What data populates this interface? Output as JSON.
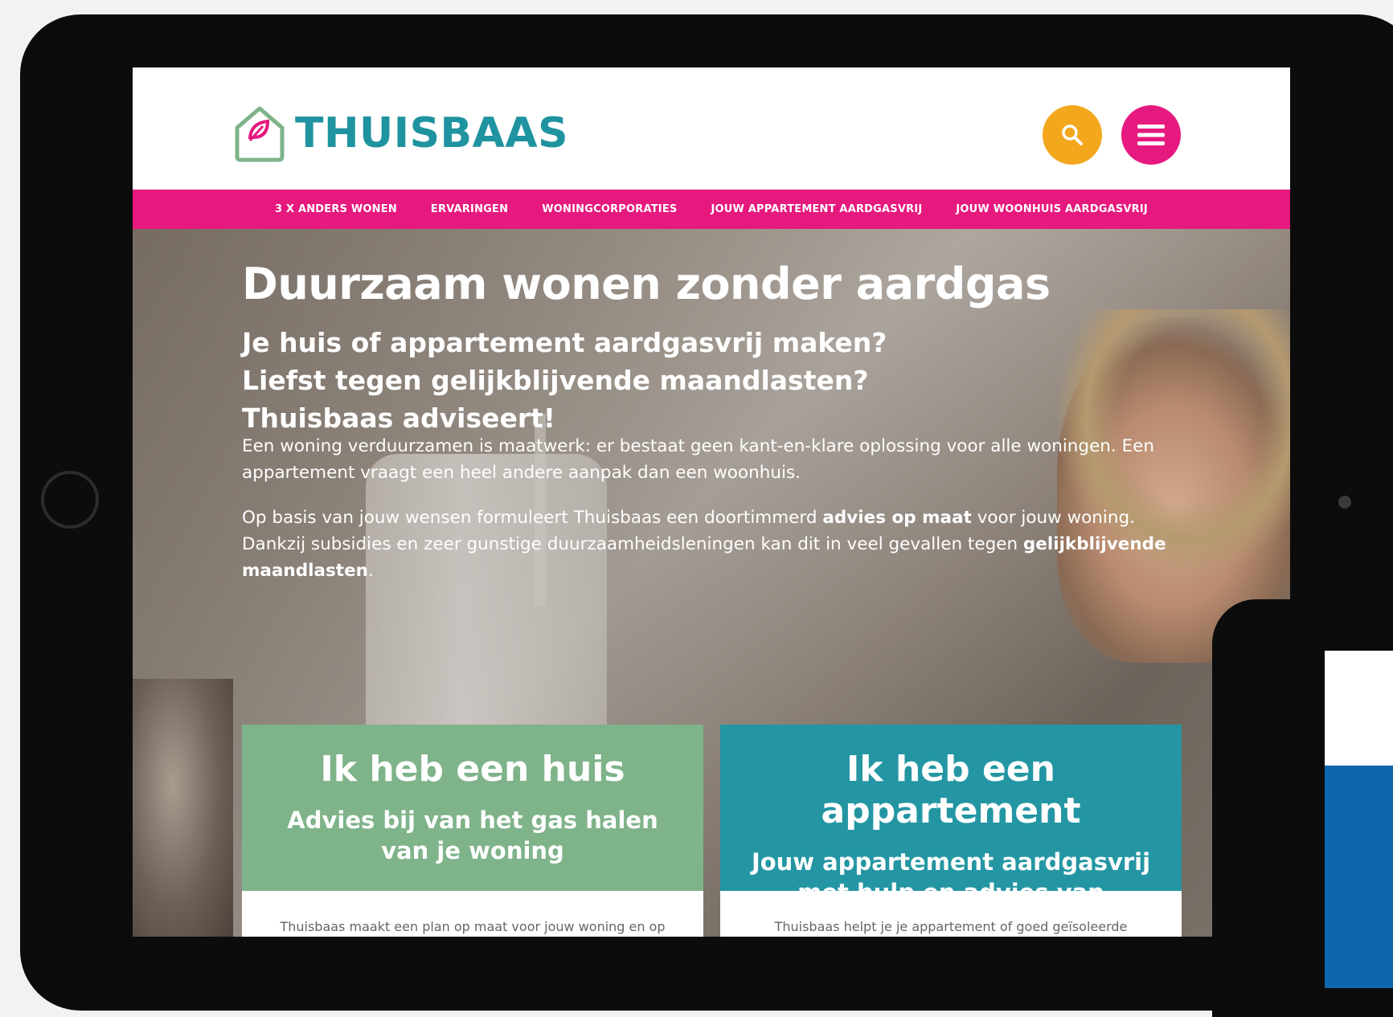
{
  "brand": {
    "name": "THUISBAAS",
    "colors": {
      "teal": "#1f93a0",
      "pink": "#e6197f",
      "yellow": "#f2a71c",
      "green": "#7fb38a"
    }
  },
  "header": {
    "search_icon": "search-icon",
    "menu_icon": "menu-icon"
  },
  "nav": {
    "items": [
      "3 X ANDERS WONEN",
      "ERVARINGEN",
      "WONINGCORPORATIES",
      "JOUW APPARTEMENT AARDGASVRIJ",
      "JOUW WOONHUIS AARDGASVRIJ"
    ]
  },
  "hero": {
    "title": "Duurzaam wonen zonder aardgas",
    "subtitle_lines": [
      "Je huis of appartement aardgasvrij maken?",
      "Liefst tegen gelijkblijvende maandlasten?",
      "Thuisbaas adviseert!"
    ],
    "paragraph1": "Een woning verduurzamen is maatwerk: er bestaat geen kant-en-klare oplossing voor alle woningen. Een appartement vraagt een heel andere aanpak dan een woonhuis.",
    "paragraph2": {
      "part1": "Op basis van jouw wensen formuleert Thuisbaas een doortimmerd ",
      "bold1": "advies op maat",
      "part2": " voor jouw woning. Dankzij subsidies en zeer gunstige duurzaamheidsleningen kan dit in veel gevallen tegen ",
      "bold2": "gelijkblijvende maandlasten",
      "part3": "."
    }
  },
  "cards": [
    {
      "title": "Ik heb een huis",
      "subtitle": "Advies bij van het gas halen van je woning",
      "body": "Thuisbaas maakt een plan op maat voor jouw woning en op basis van jouw wensen."
    },
    {
      "title": "Ik heb een appartement",
      "subtitle": "Jouw appartement aardgasvrij met hulp en advies van Thuisbaas",
      "body": "Thuisbaas helpt je je appartement of goed geïsoleerde tussenwoning volledig van het gas af te halen. Dit kunnen we ook voor je uitvoeren, ook terwijl je in je woning woont."
    }
  ]
}
